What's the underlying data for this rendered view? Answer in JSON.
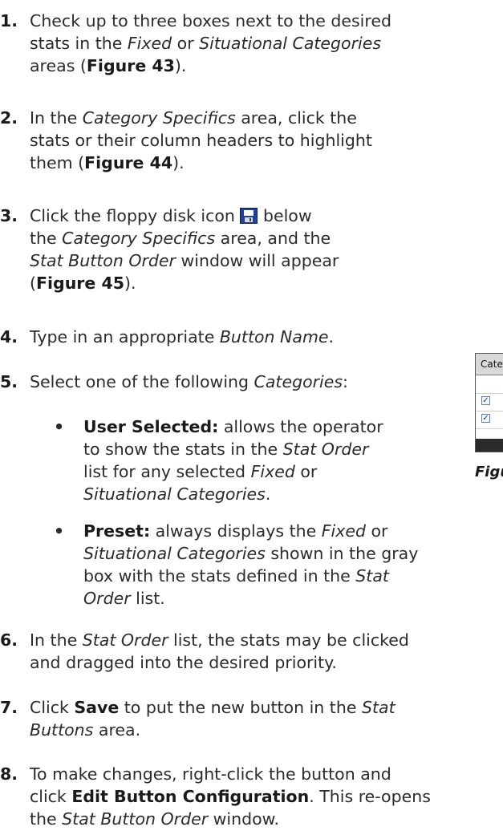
{
  "steps": [
    {
      "num": "1.",
      "lines": [
        [
          {
            "t": "Check up to three boxes next to the desired"
          }
        ],
        [
          {
            "t": "stats in the "
          },
          {
            "t": "Fixed",
            "i": true
          },
          {
            "t": " or "
          },
          {
            "t": "Situational Categories",
            "i": true
          }
        ],
        [
          {
            "t": "areas ("
          },
          {
            "t": "Figure 43",
            "b": true
          },
          {
            "t": ")."
          }
        ]
      ]
    },
    {
      "num": "2.",
      "lines": [
        [
          {
            "t": "In the "
          },
          {
            "t": "Category Specifics",
            "i": true
          },
          {
            "t": " area, click the"
          }
        ],
        [
          {
            "t": "stats or their column headers to highlight"
          }
        ],
        [
          {
            "t": "them ("
          },
          {
            "t": "Figure 44",
            "b": true
          },
          {
            "t": ")."
          }
        ]
      ]
    },
    {
      "num": "3.",
      "lines": [
        [
          {
            "t": "Click the floppy disk icon "
          },
          {
            "icon": "floppy-disk-icon"
          },
          {
            "t": " below"
          }
        ],
        [
          {
            "t": "the "
          },
          {
            "t": "Category Specifics",
            "i": true
          },
          {
            "t": " area, and the"
          }
        ],
        [
          {
            "t": "Stat Button Order",
            "i": true
          },
          {
            "t": " window will appear"
          }
        ],
        [
          {
            "t": "("
          },
          {
            "t": "Figure 45",
            "b": true
          },
          {
            "t": ")."
          }
        ]
      ]
    },
    {
      "num": "4.",
      "lines": [
        [
          {
            "t": "Type in an appropriate "
          },
          {
            "t": "Button Name",
            "i": true
          },
          {
            "t": "."
          }
        ]
      ]
    },
    {
      "num": "5.",
      "lines": [
        [
          {
            "t": "Select one of the following "
          },
          {
            "t": "Categories",
            "i": true
          },
          {
            "t": ":"
          }
        ]
      ]
    },
    {
      "num": "6.",
      "lines": [
        [
          {
            "t": "In the "
          },
          {
            "t": "Stat Order",
            "i": true
          },
          {
            "t": " list, the stats may be clicked"
          }
        ],
        [
          {
            "t": "and dragged into the desired priority."
          }
        ]
      ]
    },
    {
      "num": "7.",
      "lines": [
        [
          {
            "t": "Click "
          },
          {
            "t": "Save",
            "b": true
          },
          {
            "t": " to put the new button in the "
          },
          {
            "t": "Stat",
            "i": true
          }
        ],
        [
          {
            "t": "Buttons",
            "i": true
          },
          {
            "t": " area."
          }
        ]
      ]
    },
    {
      "num": "8.",
      "lines": [
        [
          {
            "t": "To make changes, right-click the button and"
          }
        ],
        [
          {
            "t": "click "
          },
          {
            "t": "Edit Button Configuration",
            "b": true
          },
          {
            "t": ". This re-opens"
          }
        ],
        [
          {
            "t": "the "
          },
          {
            "t": "Stat Button Order",
            "i": true
          },
          {
            "t": " window."
          }
        ]
      ]
    }
  ],
  "bullets": [
    {
      "dot": "•",
      "lines": [
        [
          {
            "t": "User Selected:",
            "b": true
          },
          {
            "t": " allows the operator"
          }
        ],
        [
          {
            "t": "to show the stats in the "
          },
          {
            "t": "Stat Order",
            "i": true
          }
        ],
        [
          {
            "t": "list for any selected "
          },
          {
            "t": "Fixed",
            "i": true
          },
          {
            "t": " or"
          }
        ],
        [
          {
            "t": "Situational Categories",
            "i": true
          },
          {
            "t": "."
          }
        ]
      ]
    },
    {
      "dot": "•",
      "lines": [
        [
          {
            "t": "Preset:",
            "b": true
          },
          {
            "t": " always displays the "
          },
          {
            "t": "Fixed",
            "i": true
          },
          {
            "t": " or"
          }
        ],
        [
          {
            "t": "Situational Categories",
            "i": true
          },
          {
            "t": " shown in the gray"
          }
        ],
        [
          {
            "t": "box with the stats defined in the "
          },
          {
            "t": "Stat",
            "i": true
          }
        ],
        [
          {
            "t": "Order",
            "i": true
          },
          {
            "t": " list."
          }
        ]
      ]
    }
  ],
  "figure": {
    "header": "Cate",
    "checkboxes": [
      "✓",
      "✓"
    ],
    "caption": "Figu"
  }
}
